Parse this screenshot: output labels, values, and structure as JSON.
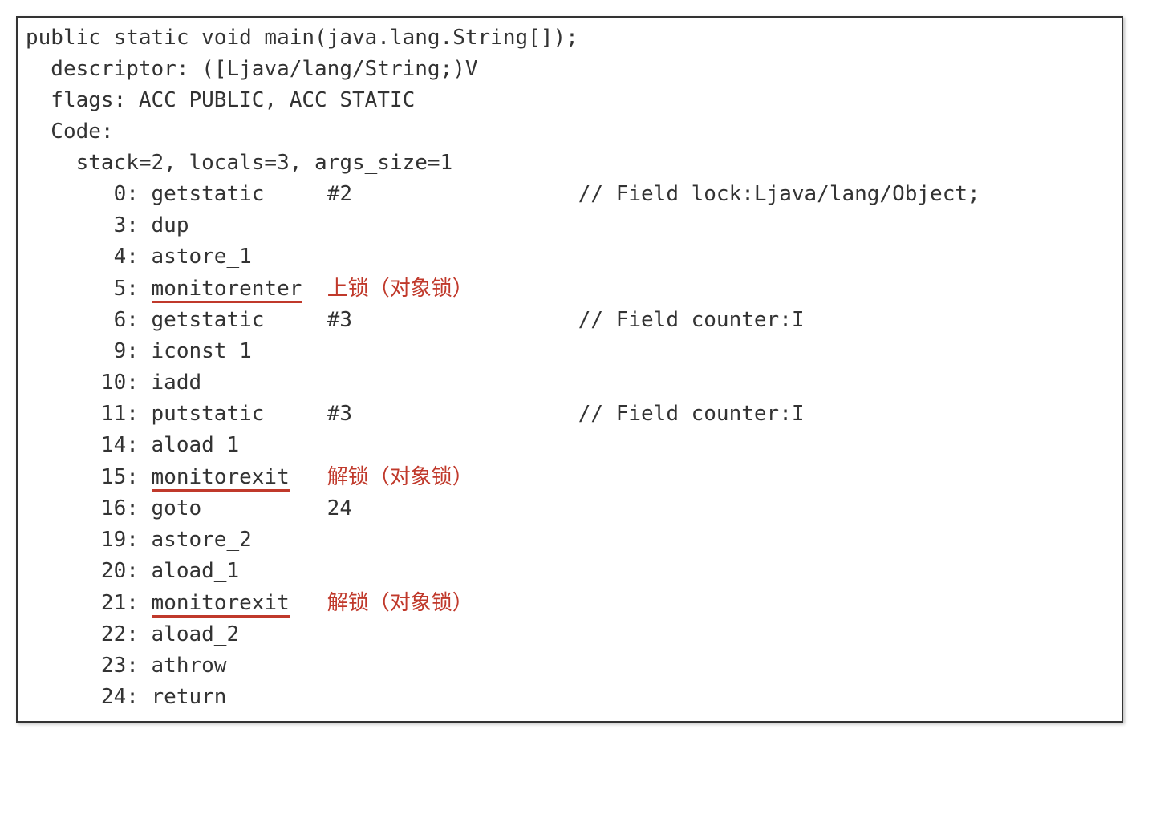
{
  "header": {
    "signature": "public static void main(java.lang.String[]);",
    "descriptor_label": "  descriptor: ([Ljava/lang/String;)V",
    "flags_label": "  flags: ACC_PUBLIC, ACC_STATIC",
    "code_label": "  Code:",
    "stack_line": "    stack=2, locals=3, args_size=1"
  },
  "instr": {
    "l0": "       0: getstatic     #2                  // Field lock:Ljava/lang/Object;",
    "l3": "       3: dup",
    "l4": "       4: astore_1",
    "l5_prefix": "       5: ",
    "l5_op": "monitorenter",
    "l5_pad": "  ",
    "l5_ann": "上锁（对象锁）",
    "l6": "       6: getstatic     #3                  // Field counter:I",
    "l9": "       9: iconst_1",
    "l10": "      10: iadd",
    "l11": "      11: putstatic     #3                  // Field counter:I",
    "l14": "      14: aload_1",
    "l15_prefix": "      15: ",
    "l15_op": "monitorexit",
    "l15_pad": "   ",
    "l15_ann": "解锁（对象锁）",
    "l16": "      16: goto          24",
    "l19": "      19: astore_2",
    "l20": "      20: aload_1",
    "l21_prefix": "      21: ",
    "l21_op": "monitorexit",
    "l21_pad": "   ",
    "l21_ann": "解锁（对象锁）",
    "l22": "      22: aload_2",
    "l23": "      23: athrow",
    "l24": "      24: return"
  }
}
